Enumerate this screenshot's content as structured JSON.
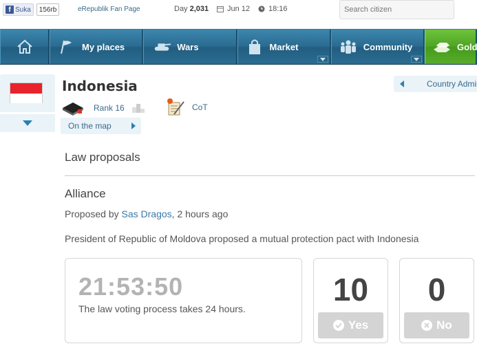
{
  "topbar": {
    "fb_like_label": "Suka",
    "fb_like_count": "156rb",
    "fan_page_link": "eRepublik Fan Page",
    "day_label": "Day",
    "day_value": "2,031",
    "date": "Jun 12",
    "time": "18:16",
    "search_placeholder": "Search citizen"
  },
  "nav": {
    "items": [
      {
        "label": "",
        "icon": "home-icon"
      },
      {
        "label": "My places",
        "icon": "flag-icon"
      },
      {
        "label": "Wars",
        "icon": "tank-icon"
      },
      {
        "label": "Market",
        "icon": "shopping-bag-icon"
      },
      {
        "label": "Community",
        "icon": "people-icon"
      },
      {
        "label": "Gold",
        "icon": "gold-bars-icon"
      }
    ]
  },
  "country": {
    "name": "Indonesia",
    "rank": "Rank 16",
    "cot": "CoT",
    "on_the_map": "On the map",
    "admin_link": "Country Administration"
  },
  "laws": {
    "section_title": "Law proposals",
    "law_title": "Alliance",
    "proposed_by_prefix": "Proposed by ",
    "proposer": "Sas Dragos",
    "proposed_suffix": ", 2 hours ago",
    "description": "President of Republic of Moldova proposed a mutual protection pact with Indonesia",
    "timer": "21:53:50",
    "timer_note": "The law voting process takes 24 hours.",
    "yes_count": "10",
    "yes_label": "Yes",
    "no_count": "0",
    "no_label": "No"
  },
  "colors": {
    "nav_blue": "#2a6a8f",
    "gold_green": "#4fa324",
    "link_blue": "#3a6a8a",
    "flag_red": "#e8232c"
  }
}
